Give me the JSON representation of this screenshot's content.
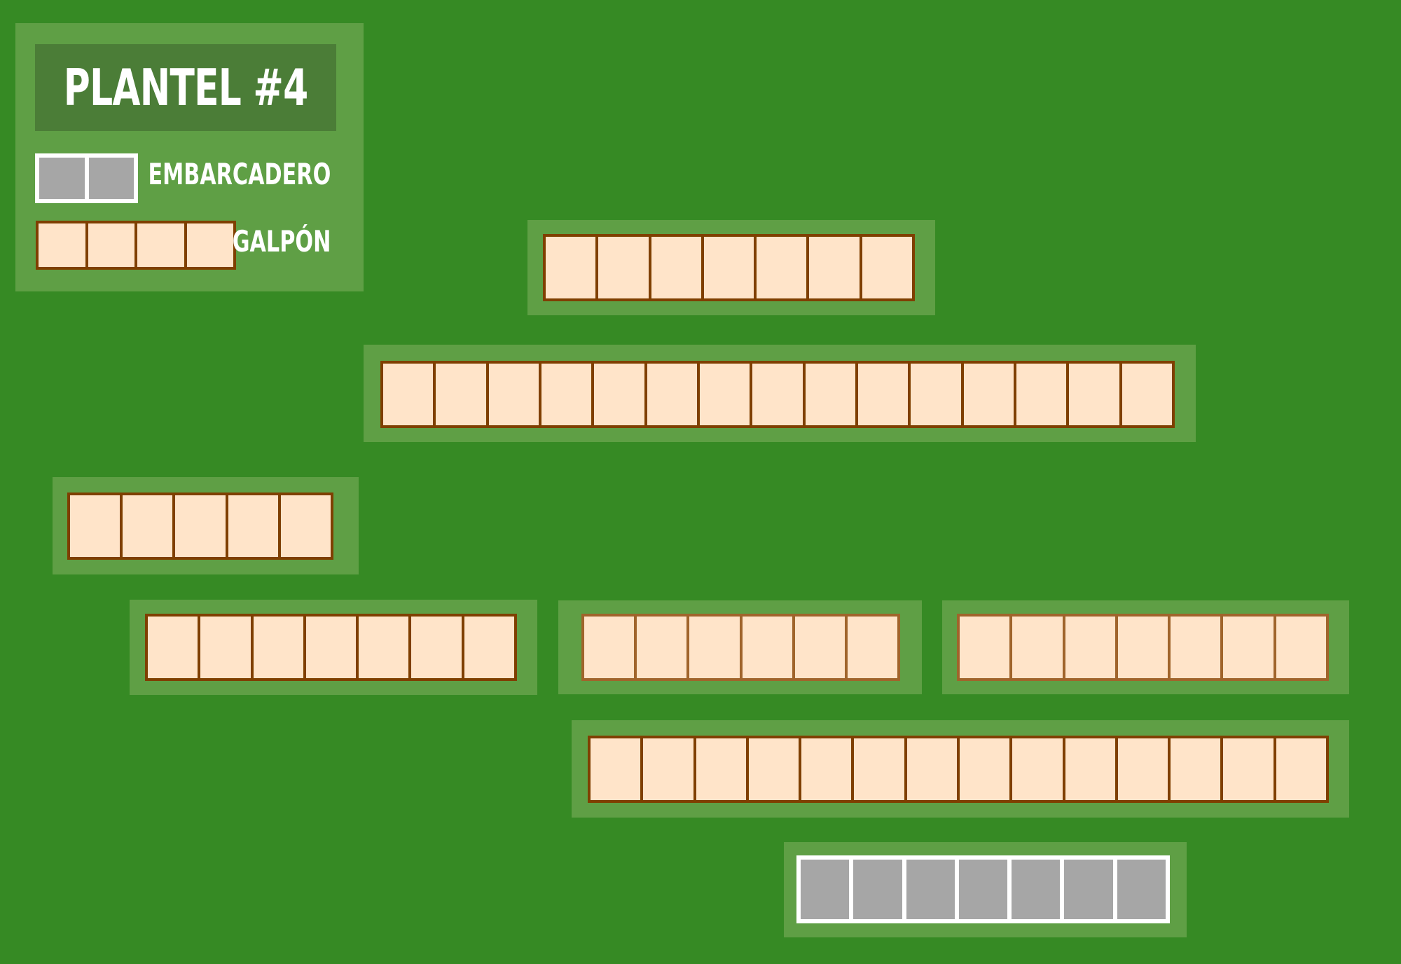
{
  "legend": {
    "title": "PLANTEL #4",
    "items": [
      {
        "label": "EMBARCADERO",
        "type": "embarcadero",
        "units": 2
      },
      {
        "label": "GALPÓN",
        "type": "galpon",
        "units": 4
      }
    ]
  },
  "rows": [
    {
      "type": "galpon",
      "units": 7
    },
    {
      "type": "galpon",
      "units": 15
    },
    {
      "type": "galpon",
      "units": 5
    },
    {
      "type": "galpon",
      "units": 7
    },
    {
      "type": "galpon",
      "units": 6
    },
    {
      "type": "galpon",
      "units": 7
    },
    {
      "type": "galpon",
      "units": 14
    },
    {
      "type": "embarcadero",
      "units": 7
    }
  ],
  "colors": {
    "background": "#368a24",
    "plate": "#5f9f45",
    "title_box": "#4b7d37",
    "galpon_fill": "#ffe4c9",
    "galpon_border": "#7f3f00",
    "embarcadero_fill": "#a6a6a6",
    "embarcadero_border": "#ffffff"
  }
}
